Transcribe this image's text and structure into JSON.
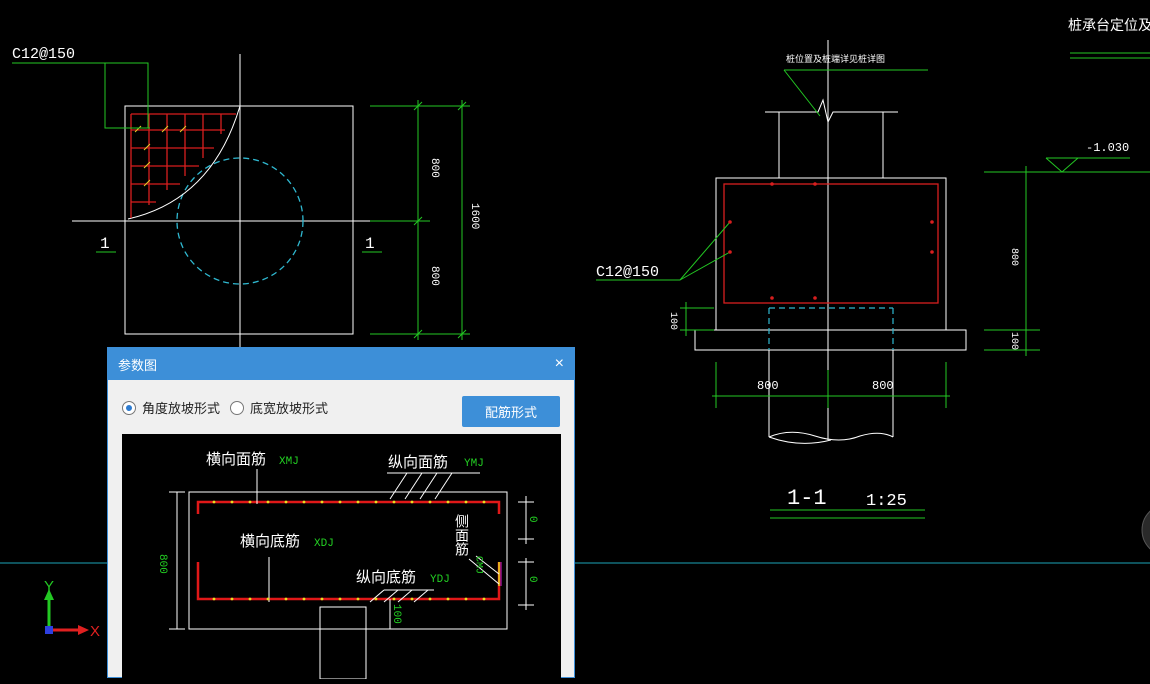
{
  "drawing": {
    "plan_rebar_label": "C12@150",
    "plan_section_mark_left": "1",
    "plan_section_mark_right": "1",
    "plan_dim_half_top": "800",
    "plan_dim_half_bottom": "800",
    "plan_dim_total": "1600",
    "section_note_top": "桩位置及桩端详见桩详图",
    "section_rebar_label": "C12@150",
    "section_dim_bottom": "100",
    "section_dim_width_left": "800",
    "section_dim_width_right": "800",
    "section_title": "1-1",
    "section_scale": "1:25",
    "elevation_label": "-1.030",
    "right_dim_height": "800",
    "right_dim_bottom": "100",
    "corner_title": "桩承台定位及配",
    "ucs_y": "Y",
    "ucs_x": "X"
  },
  "dialog": {
    "title": "参数图",
    "close_glyph": "×",
    "option_angle": "角度放坡形式",
    "option_width": "底宽放坡形式",
    "selected": "angle",
    "rebar_button": "配筋形式",
    "preview": {
      "label_top_horizontal": "横向面筋",
      "code_top_horizontal": "XMJ",
      "label_top_vertical": "纵向面筋",
      "code_top_vertical": "YMJ",
      "label_bottom_horizontal": "横向底筋",
      "code_bottom_horizontal": "XDJ",
      "label_bottom_vertical": "纵向底筋",
      "code_bottom_vertical": "YDJ",
      "label_side": "侧面筋",
      "code_side": "CMJ",
      "dim_height": "800",
      "dim_upper": "0",
      "dim_lower": "0",
      "dim_cover": "100"
    }
  }
}
